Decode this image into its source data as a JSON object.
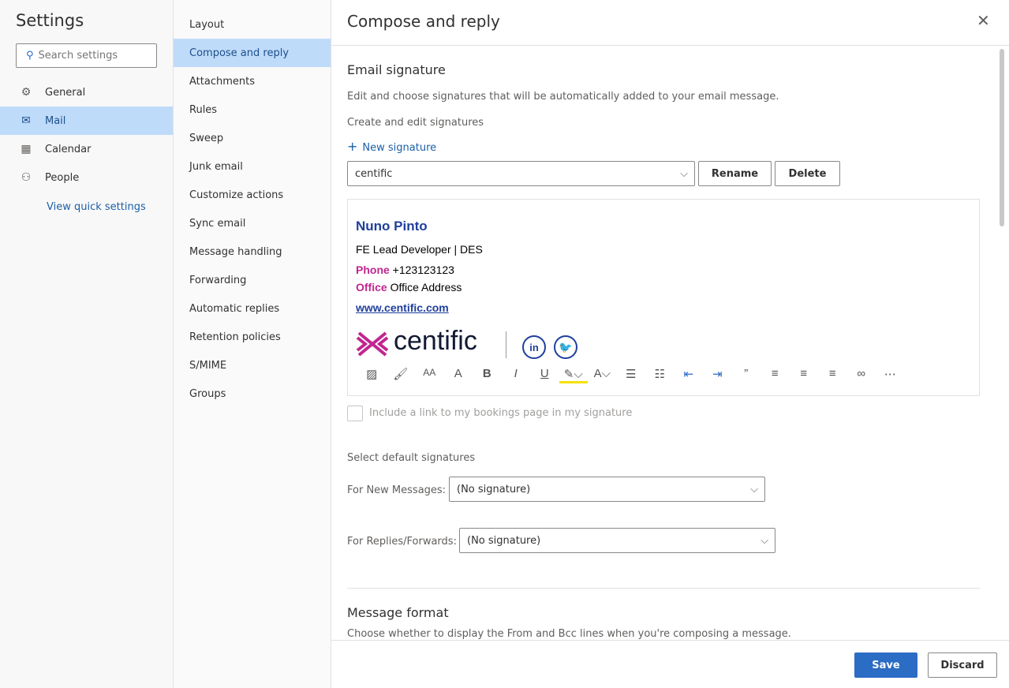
{
  "settings": {
    "title": "Settings",
    "search_placeholder": "Search settings",
    "nav": [
      {
        "label": "General",
        "icon": "gear-icon"
      },
      {
        "label": "Mail",
        "icon": "mail-icon"
      },
      {
        "label": "Calendar",
        "icon": "calendar-icon"
      },
      {
        "label": "People",
        "icon": "people-icon"
      }
    ],
    "quick": "View quick settings"
  },
  "mail_nav": [
    "Layout",
    "Compose and reply",
    "Attachments",
    "Rules",
    "Sweep",
    "Junk email",
    "Customize actions",
    "Sync email",
    "Message handling",
    "Forwarding",
    "Automatic replies",
    "Retention policies",
    "S/MIME",
    "Groups"
  ],
  "page": {
    "title": "Compose and reply",
    "email_signature": {
      "heading": "Email signature",
      "desc": "Edit and choose signatures that will be automatically added to your email message.",
      "create_label": "Create and edit signatures",
      "new_signature": "New signature",
      "selected": "centific",
      "rename": "Rename",
      "delete": "Delete",
      "signature": {
        "name": "Nuno Pinto",
        "role": "FE Lead Developer | DES",
        "phone_label": "Phone",
        "phone": "+123123123",
        "office_label": "Office",
        "office": "Office Address",
        "website": "www.centific.com",
        "logo_text": "centific",
        "social": [
          "in",
          "twitter"
        ]
      },
      "bookings": "Include a link to my bookings page in my signature"
    },
    "defaults": {
      "heading": "Select default signatures",
      "new_label": "For New Messages:",
      "new_value": "(No signature)",
      "reply_label": "For Replies/Forwards:",
      "reply_value": "(No signature)"
    },
    "format": {
      "heading": "Message format",
      "desc": "Choose whether to display the From and Bcc lines when you're composing a message."
    }
  },
  "footer": {
    "save": "Save",
    "discard": "Discard"
  },
  "colors": {
    "accent": "#2b6cc4",
    "selected": "#bfdbfa",
    "brand_magenta": "#c0268f",
    "sig_blue": "#1f3f9c"
  }
}
